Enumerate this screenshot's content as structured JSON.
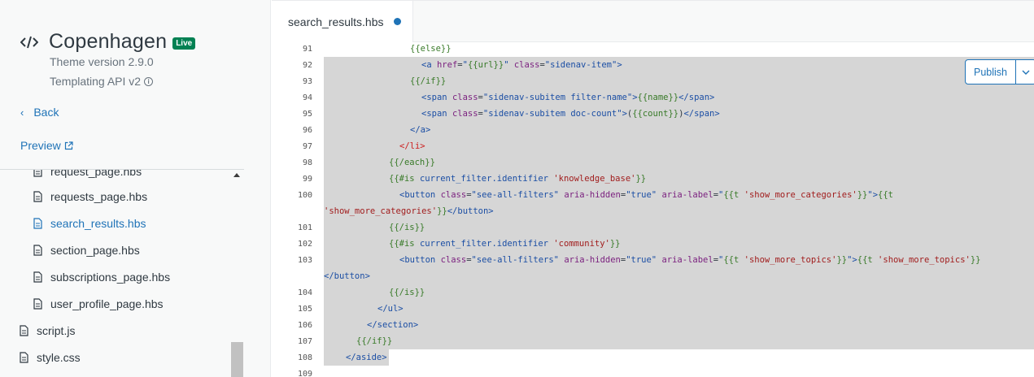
{
  "theme": {
    "name": "Copenhagen",
    "badge": "Live",
    "version": "Theme version 2.9.0",
    "api": "Templating API v2",
    "icon": "code-brackets-icon"
  },
  "nav": {
    "back_label": "Back",
    "preview_label": "Preview"
  },
  "files": [
    {
      "name": "request_page.hbs",
      "active": false
    },
    {
      "name": "requests_page.hbs",
      "active": false
    },
    {
      "name": "search_results.hbs",
      "active": true
    },
    {
      "name": "section_page.hbs",
      "active": false
    },
    {
      "name": "subscriptions_page.hbs",
      "active": false
    },
    {
      "name": "user_profile_page.hbs",
      "active": false
    },
    {
      "name": "script.js",
      "active": false
    },
    {
      "name": "style.css",
      "active": false
    }
  ],
  "editor": {
    "tab_label": "search_results.hbs",
    "publish_label": "Publish",
    "line_numbers": [
      "91",
      "92",
      "93",
      "94",
      "95",
      "96",
      "97",
      "98",
      "99",
      "100",
      "",
      "101",
      "102",
      "103",
      "",
      "104",
      "105",
      "106",
      "107",
      "108",
      "109"
    ]
  },
  "colors": {
    "accent": "#1f73b7",
    "live": "#038153",
    "selection": "#d6d6d6"
  }
}
